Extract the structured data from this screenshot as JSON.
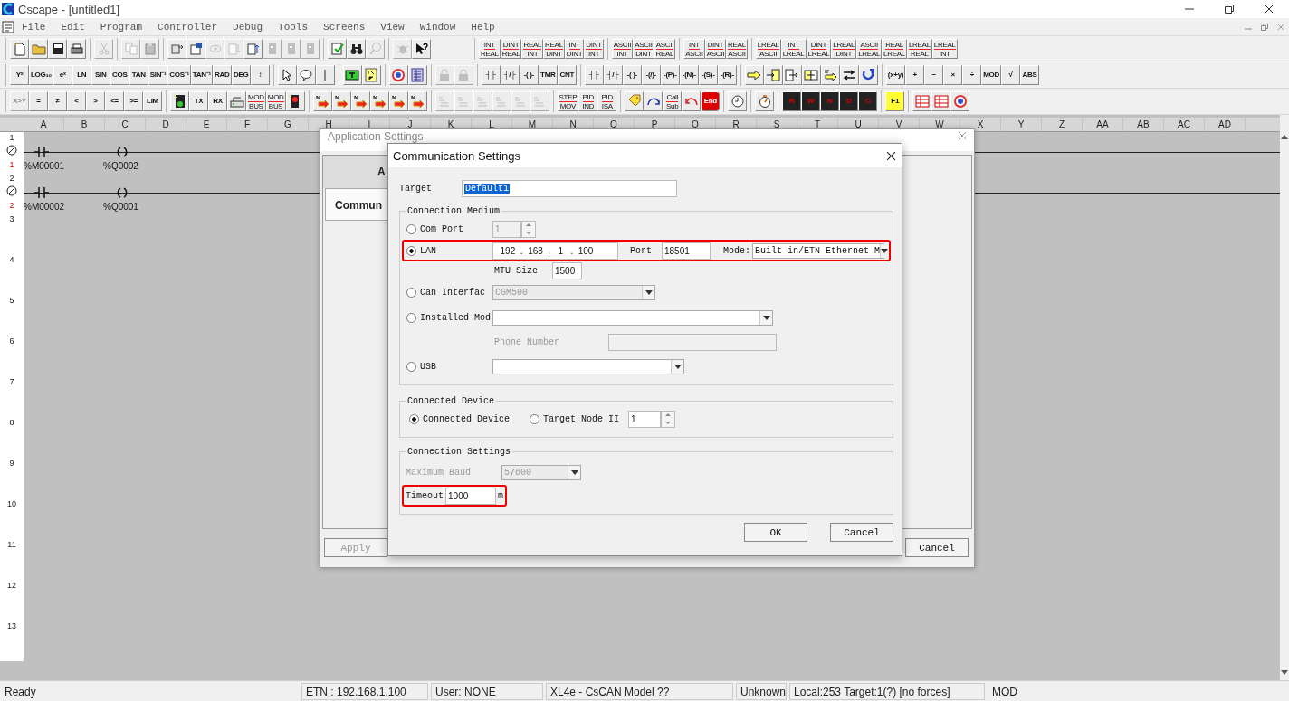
{
  "window": {
    "title": "Cscape - [untitled1]"
  },
  "menu": [
    "File",
    "Edit",
    "Program",
    "Controller",
    "Debug",
    "Tools",
    "Screens",
    "View",
    "Window",
    "Help"
  ],
  "toolbars": [
    [
      [
        {
          "kind": "new-doc",
          "disabled": false
        },
        {
          "kind": "folder",
          "disabled": false
        },
        {
          "kind": "disk",
          "disabled": false
        },
        {
          "kind": "printer",
          "disabled": false
        }
      ],
      [
        {
          "kind": "scissors",
          "disabled": true
        }
      ],
      [
        {
          "kind": "copy",
          "disabled": true
        },
        {
          "kind": "paste",
          "disabled": true
        }
      ],
      [
        {
          "kind": "transfer",
          "disabled": false
        },
        {
          "kind": "config",
          "disabled": false
        },
        {
          "kind": "eye",
          "disabled": true
        },
        {
          "kind": "doc-down",
          "disabled": true
        },
        {
          "kind": "doc-up",
          "disabled": false
        },
        {
          "kind": "page",
          "disabled": true
        },
        {
          "kind": "page",
          "disabled": true
        },
        {
          "kind": "page",
          "disabled": true
        }
      ],
      [
        {
          "kind": "check-doc",
          "disabled": false
        },
        {
          "kind": "binoculars",
          "disabled": false
        },
        {
          "kind": "magnifier",
          "disabled": true
        }
      ],
      [
        {
          "kind": "bug",
          "disabled": true
        },
        {
          "kind": "help",
          "disabled": false
        }
      ],
      [
        {
          "kind": "convert",
          "label": "INT",
          "sub": "REAL",
          "disabled": false
        },
        {
          "kind": "convert",
          "label": "DINT",
          "sub": "REAL",
          "disabled": false
        },
        {
          "kind": "convert",
          "label": "REAL",
          "sub": "INT",
          "disabled": false
        },
        {
          "kind": "convert",
          "label": "REAL",
          "sub": "DINT",
          "disabled": false
        },
        {
          "kind": "convert",
          "label": "INT",
          "sub": "DINT",
          "disabled": false
        },
        {
          "kind": "convert",
          "label": "DINT",
          "sub": "INT",
          "disabled": false
        }
      ],
      [
        {
          "kind": "convert",
          "label": "ASCII",
          "sub": "INT",
          "disabled": false
        },
        {
          "kind": "convert",
          "label": "ASCII",
          "sub": "DINT",
          "disabled": false
        },
        {
          "kind": "convert",
          "label": "ASCII",
          "sub": "REAL",
          "disabled": false
        }
      ],
      [
        {
          "kind": "convert",
          "label": "INT",
          "sub": "ASCII",
          "disabled": false
        },
        {
          "kind": "convert",
          "label": "DINT",
          "sub": "ASCII",
          "disabled": false
        },
        {
          "kind": "convert",
          "label": "REAL",
          "sub": "ASCII",
          "disabled": false
        }
      ],
      [
        {
          "kind": "convert",
          "label": "LREAL",
          "sub": "ASCII",
          "disabled": false
        },
        {
          "kind": "convert",
          "label": "INT",
          "sub": "LREAL",
          "disabled": false
        },
        {
          "kind": "convert",
          "label": "DINT",
          "sub": "LREAL",
          "disabled": false
        },
        {
          "kind": "convert",
          "label": "LREAL",
          "sub": "DINT",
          "disabled": false
        },
        {
          "kind": "convert",
          "label": "ASCII",
          "sub": "LREAL",
          "disabled": false
        },
        {
          "kind": "convert",
          "label": "REAL",
          "sub": "LREAL",
          "disabled": false
        },
        {
          "kind": "convert",
          "label": "LREAL",
          "sub": "REAL",
          "disabled": false
        },
        {
          "kind": "convert",
          "label": "LREAL",
          "sub": "INT",
          "disabled": false
        }
      ]
    ],
    [
      [
        {
          "kind": "text",
          "label": "Yˣ",
          "disabled": false
        },
        {
          "kind": "text",
          "label": "LOG₁₀",
          "disabled": false
        },
        {
          "kind": "text",
          "label": "eˣ",
          "disabled": false
        },
        {
          "kind": "text",
          "label": "LN",
          "disabled": false
        },
        {
          "kind": "text",
          "label": "SIN",
          "disabled": false
        },
        {
          "kind": "text",
          "label": "COS",
          "disabled": false
        },
        {
          "kind": "text",
          "label": "TAN",
          "disabled": false
        },
        {
          "kind": "text",
          "label": "SIN⁻¹",
          "disabled": false
        },
        {
          "kind": "text",
          "label": "COS⁻¹",
          "disabled": false
        },
        {
          "kind": "text",
          "label": "TAN⁻¹",
          "disabled": false
        },
        {
          "kind": "text",
          "label": "RAD",
          "disabled": false
        },
        {
          "kind": "text",
          "label": "DEG",
          "disabled": false
        },
        {
          "kind": "text",
          "label": "↕",
          "disabled": false
        }
      ],
      [
        {
          "kind": "pointer",
          "disabled": false
        },
        {
          "kind": "speech",
          "disabled": false
        },
        {
          "kind": "bar",
          "disabled": false
        }
      ],
      [
        {
          "kind": "t-box",
          "disabled": false
        },
        {
          "kind": "io-box",
          "disabled": false
        }
      ],
      [
        {
          "kind": "target",
          "disabled": false
        },
        {
          "kind": "table",
          "disabled": false
        }
      ],
      [
        {
          "kind": "lock",
          "disabled": true
        },
        {
          "kind": "lock",
          "disabled": true
        }
      ],
      [
        {
          "kind": "text",
          "label": "┤├",
          "disabled": false
        },
        {
          "kind": "text",
          "label": "┤/├",
          "disabled": false
        },
        {
          "kind": "text",
          "label": "-( )-",
          "disabled": false
        },
        {
          "kind": "text",
          "label": "TMR",
          "disabled": false
        },
        {
          "kind": "text",
          "label": "CNT",
          "disabled": false
        }
      ],
      [
        {
          "kind": "text",
          "label": "┤├",
          "disabled": false
        },
        {
          "kind": "text",
          "label": "┤/├",
          "disabled": false
        },
        {
          "kind": "text",
          "label": "-( )-",
          "disabled": false
        },
        {
          "kind": "text",
          "label": "-(/)-",
          "disabled": false
        },
        {
          "kind": "text",
          "label": "-(P)-",
          "disabled": false
        },
        {
          "kind": "text",
          "label": "-(N)-",
          "disabled": false
        },
        {
          "kind": "text",
          "label": "-(S)-",
          "disabled": false
        },
        {
          "kind": "text",
          "label": "-(R)-",
          "disabled": false
        }
      ],
      [
        {
          "kind": "arrow-right",
          "disabled": false
        },
        {
          "kind": "box-in",
          "disabled": false
        },
        {
          "kind": "box-out",
          "disabled": false
        },
        {
          "kind": "box-swap",
          "disabled": false
        },
        {
          "kind": "number-arrow",
          "disabled": false
        },
        {
          "kind": "swap",
          "disabled": false
        },
        {
          "kind": "loop",
          "disabled": false
        }
      ],
      [
        {
          "kind": "text",
          "label": "(x+y)",
          "disabled": false
        },
        {
          "kind": "text",
          "label": "+",
          "disabled": false
        },
        {
          "kind": "text",
          "label": "−",
          "disabled": false
        },
        {
          "kind": "text",
          "label": "×",
          "disabled": false
        },
        {
          "kind": "text",
          "label": "÷",
          "disabled": false
        },
        {
          "kind": "text",
          "label": "MOD",
          "disabled": false
        },
        {
          "kind": "text",
          "label": "√",
          "disabled": false
        },
        {
          "kind": "text",
          "label": "ABS",
          "disabled": false
        }
      ]
    ],
    [
      [
        {
          "kind": "text",
          "label": "X>Y",
          "disabled": true
        },
        {
          "kind": "text",
          "label": "=",
          "disabled": false
        },
        {
          "kind": "text",
          "label": "≠",
          "disabled": false
        },
        {
          "kind": "text",
          "label": "<",
          "disabled": false
        },
        {
          "kind": "text",
          "label": ">",
          "disabled": false
        },
        {
          "kind": "text",
          "label": "<=",
          "disabled": false
        },
        {
          "kind": "text",
          "label": ">=",
          "disabled": false
        },
        {
          "kind": "text",
          "label": "LIM",
          "disabled": false
        }
      ],
      [
        {
          "kind": "disk-green",
          "disabled": false
        },
        {
          "kind": "text",
          "label": "TX",
          "disabled": false
        },
        {
          "kind": "text",
          "label": "RX",
          "disabled": false
        },
        {
          "kind": "network",
          "disabled": false
        },
        {
          "kind": "convert",
          "label": "MOD",
          "sub": "BUS",
          "disabled": false
        },
        {
          "kind": "convert",
          "label": "MOD",
          "sub": "BUS",
          "disabled": false
        },
        {
          "kind": "red-light",
          "disabled": false
        }
      ],
      [
        {
          "kind": "n-arrow",
          "disabled": false
        },
        {
          "kind": "n-arrow",
          "disabled": false
        },
        {
          "kind": "n-arrow",
          "disabled": false
        },
        {
          "kind": "n-arrow",
          "disabled": false
        },
        {
          "kind": "n-arrow",
          "disabled": false
        },
        {
          "kind": "n-arrow",
          "disabled": false
        }
      ],
      [
        {
          "kind": "gray-func",
          "disabled": true
        },
        {
          "kind": "gray-func",
          "disabled": true
        },
        {
          "kind": "gray-func",
          "disabled": true
        },
        {
          "kind": "gray-func",
          "disabled": true
        },
        {
          "kind": "gray-func",
          "disabled": true
        },
        {
          "kind": "gray-func",
          "disabled": true
        }
      ],
      [
        {
          "kind": "convert",
          "label": "STEP",
          "sub": "MOV",
          "disabled": false
        },
        {
          "kind": "convert",
          "label": "PID",
          "sub": "IND",
          "disabled": false
        },
        {
          "kind": "convert",
          "label": "PID",
          "sub": "ISA",
          "disabled": false
        }
      ],
      [
        {
          "kind": "tag",
          "disabled": false
        },
        {
          "kind": "curve-arrow",
          "disabled": false
        },
        {
          "kind": "convert",
          "label": "Call",
          "sub": "Sub",
          "disabled": false
        },
        {
          "kind": "undo-arrow",
          "disabled": false
        },
        {
          "kind": "stop",
          "label": "End",
          "disabled": false
        }
      ],
      [
        {
          "kind": "clock",
          "disabled": false
        }
      ],
      [
        {
          "kind": "timer",
          "disabled": false
        }
      ],
      [
        {
          "kind": "disk-letter",
          "label": "R",
          "disabled": false
        },
        {
          "kind": "disk-letter",
          "label": "W",
          "disabled": false
        },
        {
          "kind": "disk-letter",
          "label": "N",
          "disabled": false
        },
        {
          "kind": "disk-letter",
          "label": "D",
          "disabled": false
        },
        {
          "kind": "disk-letter",
          "label": "C",
          "disabled": false
        }
      ],
      [
        {
          "kind": "note",
          "label": "F1",
          "disabled": false
        }
      ],
      [
        {
          "kind": "table-red",
          "disabled": false
        },
        {
          "kind": "table-red",
          "disabled": false
        },
        {
          "kind": "target",
          "disabled": false
        }
      ]
    ]
  ],
  "ladder": {
    "columns": [
      "A",
      "B",
      "C",
      "D",
      "E",
      "F",
      "G",
      "H",
      "I",
      "J",
      "K",
      "L",
      "M",
      "N",
      "O",
      "P",
      "Q",
      "R",
      "S",
      "T",
      "U",
      "V",
      "W",
      "X",
      "Y",
      "Z",
      "AA",
      "AB",
      "AC",
      "AD"
    ],
    "rows": [
      {
        "number": "1",
        "rung": "1",
        "contact": "%M00001",
        "coil": "%Q0002"
      },
      {
        "number": "2",
        "rung": "2",
        "contact": "%M00002",
        "coil": "%Q0001"
      },
      {
        "number": "3"
      },
      {
        "number": "4"
      },
      {
        "number": "5"
      },
      {
        "number": "6"
      },
      {
        "number": "7"
      },
      {
        "number": "8"
      },
      {
        "number": "9"
      },
      {
        "number": "10"
      },
      {
        "number": "11"
      },
      {
        "number": "12"
      },
      {
        "number": "13"
      }
    ]
  },
  "app_settings": {
    "title": "Application Settings",
    "tabs": [
      {
        "label": "A",
        "selected": false
      },
      {
        "label": "Commun",
        "selected": true
      }
    ],
    "apply": {
      "label": "Apply",
      "disabled": true
    },
    "cancel": "Cancel"
  },
  "comm_settings": {
    "title": "Communication Settings",
    "target_label": "Target",
    "target": "Default1",
    "connection_medium": {
      "title": "Connection Medium",
      "options": [
        {
          "kind": "com",
          "label": "Com Port",
          "selected": false,
          "value": "1"
        },
        {
          "kind": "lan",
          "label": "LAN",
          "selected": true,
          "highlighted": true,
          "ip": "  192  .  168  .   1   .  100",
          "port_label": "Port",
          "port": "18501",
          "mode_label": "Mode:",
          "mode": "Built-in/ETN Ethernet M",
          "mtu_label": "MTU Size",
          "mtu": "1500"
        },
        {
          "kind": "can",
          "label": "Can Interfac",
          "selected": false,
          "value": "CGM500"
        },
        {
          "kind": "modem",
          "label": "Installed Mod",
          "selected": false,
          "phone_label": "Phone Number"
        },
        {
          "kind": "usb",
          "label": "USB",
          "selected": false
        }
      ]
    },
    "connected_device": {
      "title": "Connected Device",
      "options": [
        {
          "label": "Connected Device",
          "selected": true
        },
        {
          "label": "Target Node II",
          "selected": false
        }
      ],
      "node": "1"
    },
    "connection_settings": {
      "title": "Connection Settings",
      "baud_label": "Maximum Baud",
      "baud": "57600",
      "timeout_label": "Timeout",
      "timeout": "1000",
      "unit": "m",
      "highlighted": true
    },
    "buttons": [
      "OK",
      "Cancel"
    ]
  },
  "status_bar": [
    "Ready",
    "ETN : 192.168.1.100",
    "User: NONE",
    "XL4e - CsCAN Model ??",
    "Unknown",
    "Local:253  Target:1(?) [no forces]",
    "MOD"
  ]
}
